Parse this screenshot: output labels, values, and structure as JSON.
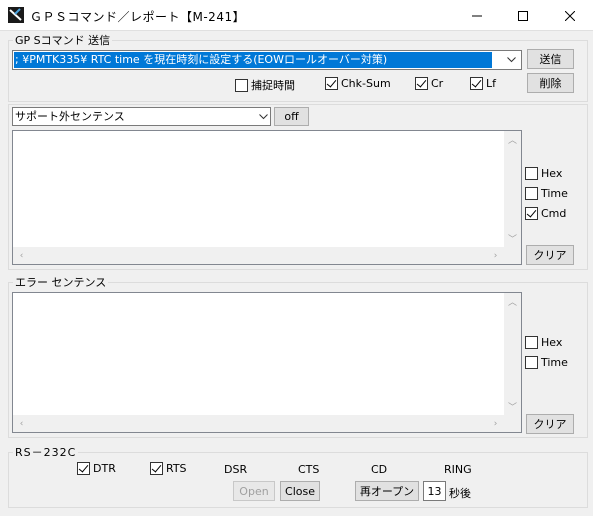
{
  "window": {
    "title": "ＧＰＳコマンド／レポート【M-241】"
  },
  "gps_command": {
    "group_label": "GP Sコマンド 送信",
    "command_value": "; ¥PMTK335¥ RTC time を現在時刻に設定する(EOWロールオーバー対策)",
    "send_label": "送信",
    "delete_label": "削除",
    "options": [
      {
        "label": "捕捉時間",
        "checked": false
      },
      {
        "label": "Chk-Sum",
        "checked": true
      },
      {
        "label": "Cr",
        "checked": true
      },
      {
        "label": "Lf",
        "checked": true
      }
    ]
  },
  "unsupported": {
    "select_value": "サポート外センテンス",
    "off_label": "off",
    "options": [
      {
        "label": "Hex",
        "checked": false
      },
      {
        "label": "Time",
        "checked": false
      },
      {
        "label": "Cmd",
        "checked": true
      }
    ],
    "clear_label": "クリア"
  },
  "error": {
    "group_label": "エラー センテンス",
    "options": [
      {
        "label": "Hex",
        "checked": false
      },
      {
        "label": "Time",
        "checked": false
      }
    ],
    "clear_label": "クリア"
  },
  "rs232c": {
    "group_label": "RS－232C",
    "dtr": {
      "label": "DTR",
      "checked": true
    },
    "rts": {
      "label": "RTS",
      "checked": true
    },
    "signals": [
      "DSR",
      "CTS",
      "CD",
      "RING"
    ],
    "open_label": "Open",
    "close_label": "Close",
    "reopen_label": "再オープン",
    "seconds_value": "13",
    "seconds_unit": "秒後"
  }
}
